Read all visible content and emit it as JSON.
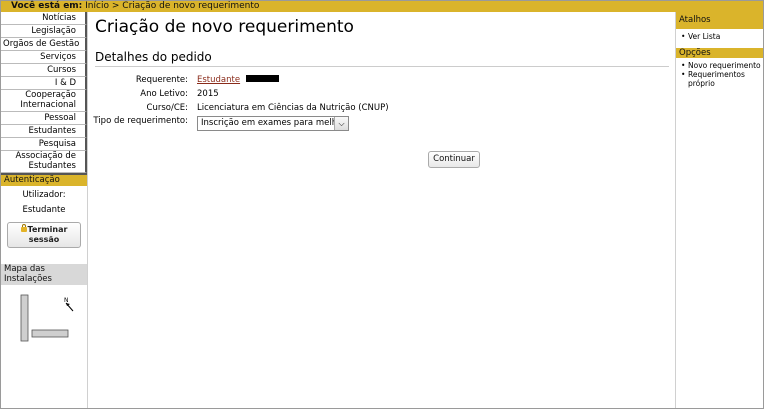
{
  "breadcrumb": {
    "prefix": "Você está em:",
    "home": "Início",
    "separator": ">",
    "current": "Criação de novo requerimento"
  },
  "nav": {
    "items": [
      {
        "label": "Notícias"
      },
      {
        "label": "Legislação"
      },
      {
        "label": "Orgãos de Gestão"
      },
      {
        "label": "Serviços"
      },
      {
        "label": "Cursos"
      },
      {
        "label": "I & D"
      },
      {
        "label": "Cooperação Internacional"
      },
      {
        "label": "Pessoal"
      },
      {
        "label": "Estudantes"
      },
      {
        "label": "Pesquisa"
      },
      {
        "label": "Associação de Estudantes"
      }
    ]
  },
  "auth": {
    "heading": "Autenticação",
    "user_label": "Utilizador:",
    "user_value": "Estudante",
    "logout_label": "Terminar sessão"
  },
  "map": {
    "heading": "Mapa das Instalações",
    "north": "N"
  },
  "main": {
    "title": "Criação de novo requerimento",
    "section": "Detalhes do pedido",
    "fields": {
      "requerente_label": "Requerente:",
      "requerente_value": "Estudante",
      "ano_label": "Ano Letivo:",
      "ano_value": "2015",
      "curso_label": "Curso/CE:",
      "curso_value": "Licenciatura em Ciências da Nutrição (CNUP)",
      "tipo_label": "Tipo de requerimento:",
      "tipo_value": "Inscrição em exames para melhoria"
    },
    "continue_label": "Continuar"
  },
  "shortcuts": {
    "heading": "Atalhos",
    "items": [
      {
        "label": "Ver Lista"
      }
    ]
  },
  "options": {
    "heading": "Opções",
    "items": [
      {
        "label": "Novo requerimento"
      },
      {
        "label": "Requerimentos próprio"
      }
    ]
  },
  "colors": {
    "accent": "#dab42b",
    "link": "#8a2b1a"
  }
}
